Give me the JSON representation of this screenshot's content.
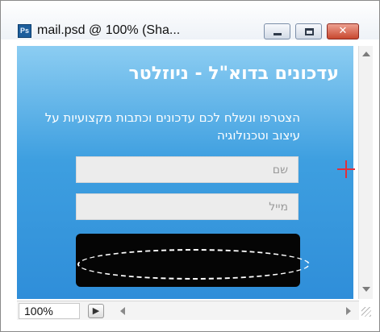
{
  "window": {
    "title": "mail.psd @ 100% (Sha...",
    "app_icon_label": "Ps",
    "close_glyph": "✕"
  },
  "canvas": {
    "heading": "עדכונים בדוא\"ל - ניוזלטר",
    "subtext": "הצטרפו ונשלח לכם עדכונים וכתבות מקצועיות על עיצוב וטכנולוגיה",
    "name_placeholder": "שם",
    "email_placeholder": "מייל"
  },
  "status": {
    "zoom": "100%",
    "button_glyph": "▶"
  },
  "colors": {
    "canvas_top": "#8ccdf2",
    "canvas_bottom": "#2f8ed9",
    "crosshair": "#e0303c"
  }
}
